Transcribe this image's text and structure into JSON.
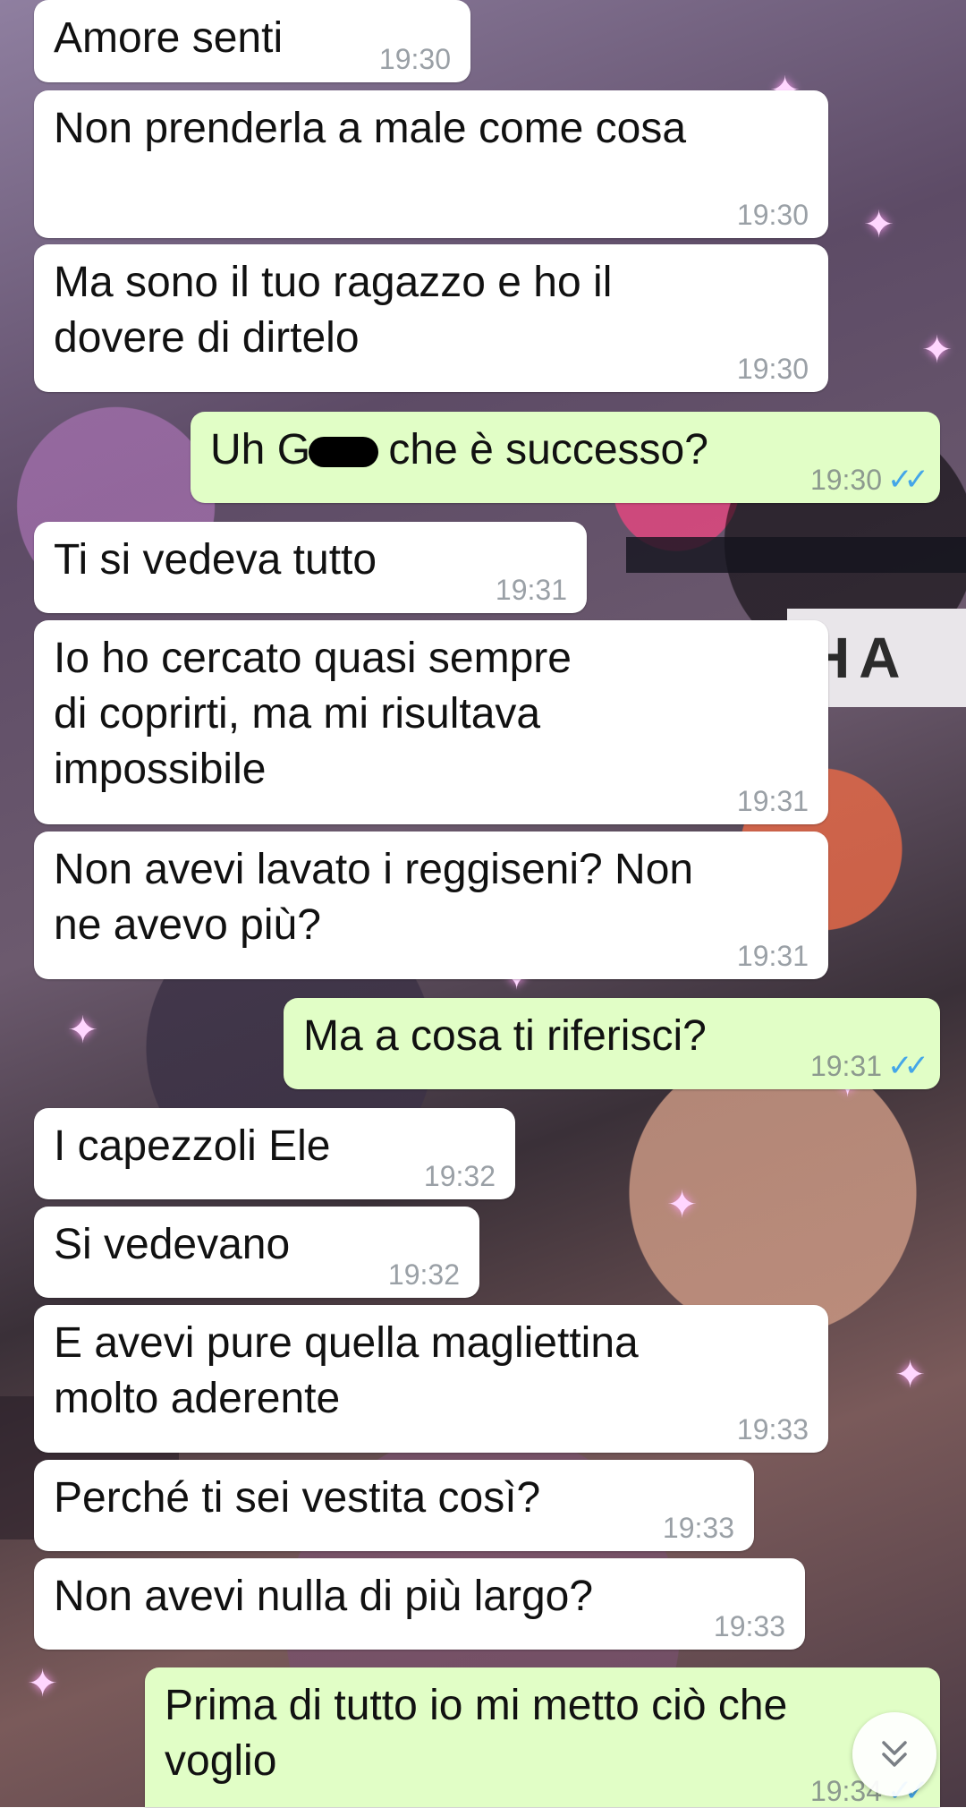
{
  "messages": [
    {
      "dir": "in",
      "text": "Amore senti",
      "time": "19:30"
    },
    {
      "dir": "in",
      "text": "Non prenderla a male come cosa",
      "time": "19:30"
    },
    {
      "dir": "in",
      "text": "Ma sono il tuo ragazzo e ho il\ndovere di dirtelo",
      "time": "19:30"
    },
    {
      "dir": "out",
      "text_a": "Uh G",
      "text_b": " che è successo?",
      "time": "19:30",
      "status": "read"
    },
    {
      "dir": "in",
      "text": "Ti si vedeva tutto",
      "time": "19:31"
    },
    {
      "dir": "in",
      "text": "Io ho cercato quasi sempre\ndi coprirti, ma mi risultava\nimpossibile",
      "time": "19:31"
    },
    {
      "dir": "in",
      "text": "Non avevi lavato i reggiseni? Non\nne avevo più?",
      "time": "19:31"
    },
    {
      "dir": "out",
      "text": "Ma a cosa ti riferisci?",
      "time": "19:31",
      "status": "read"
    },
    {
      "dir": "in",
      "text": "I capezzoli Ele",
      "time": "19:32"
    },
    {
      "dir": "in",
      "text": "Si vedevano",
      "time": "19:32"
    },
    {
      "dir": "in",
      "text": "E avevi pure quella magliettina\nmolto aderente",
      "time": "19:33"
    },
    {
      "dir": "in",
      "text": "Perché ti sei vestita così?",
      "time": "19:33"
    },
    {
      "dir": "in",
      "text": "Non avevi nulla di più largo?",
      "time": "19:33"
    },
    {
      "dir": "out",
      "text": "Prima di tutto io mi metto ciò che\nvoglio",
      "time": "19:34",
      "status": "read"
    }
  ],
  "wallpaper": {
    "banner_text": "HA"
  },
  "icons": {
    "read_ticks": "✓✓",
    "scroll_down": "chevron-double-down-icon"
  },
  "colors": {
    "incoming": "#ffffff",
    "outgoing": "#e1fec6",
    "read_tick": "#44a6e8"
  }
}
